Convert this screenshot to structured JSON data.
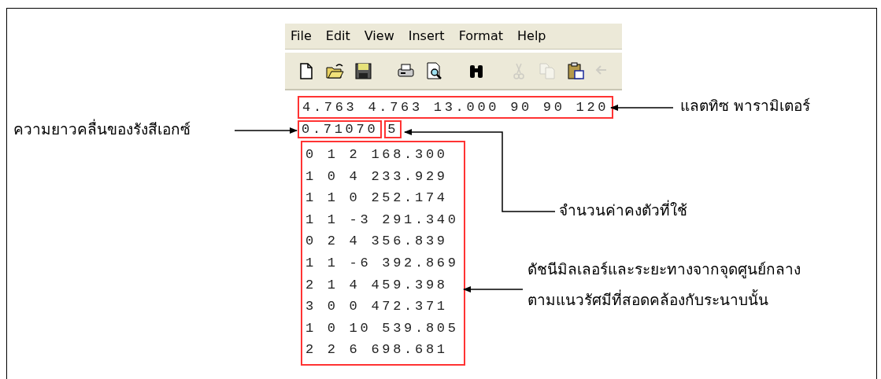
{
  "menu": [
    "File",
    "Edit",
    "View",
    "Insert",
    "Format",
    "Help"
  ],
  "toolbar": [
    {
      "kind": "new",
      "disabled": false
    },
    {
      "kind": "open",
      "disabled": false
    },
    {
      "kind": "save",
      "disabled": false
    },
    {
      "kind": "gap"
    },
    {
      "kind": "print",
      "disabled": false
    },
    {
      "kind": "preview",
      "disabled": false
    },
    {
      "kind": "gap"
    },
    {
      "kind": "find",
      "disabled": false
    },
    {
      "kind": "gap"
    },
    {
      "kind": "cut",
      "disabled": true
    },
    {
      "kind": "copy",
      "disabled": true
    },
    {
      "kind": "paste",
      "disabled": false
    },
    {
      "kind": "undo",
      "disabled": true
    }
  ],
  "document": {
    "lattice_line": "4.763 4.763 13.000 90 90 120",
    "wavelength": "0.71070",
    "count": "5",
    "reflections": [
      "0 1 2 168.300",
      "1 0 4 233.929",
      "1 1 0 252.174",
      "1 1 -3 291.340",
      "0 2 4 356.839",
      "1 1 -6 392.869",
      "2 1 4 459.398",
      "3 0 0 472.371",
      "1 0 10 539.805",
      "2 2 6 698.681"
    ]
  },
  "annotations": {
    "lattice": "แลตทิซ พารามิเตอร์",
    "wavelength": "ความยาวคลื่นของรังสีเอกซ์",
    "count": "จำนวนค่าคงตัวที่ใช้",
    "reflections": [
      "ดัชนีมิลเลอร์และระยะทางจากจุดศูนย์กลาง",
      "ตามแนวรัศมีที่สอดคล้องกับระนาบนั้น"
    ]
  }
}
